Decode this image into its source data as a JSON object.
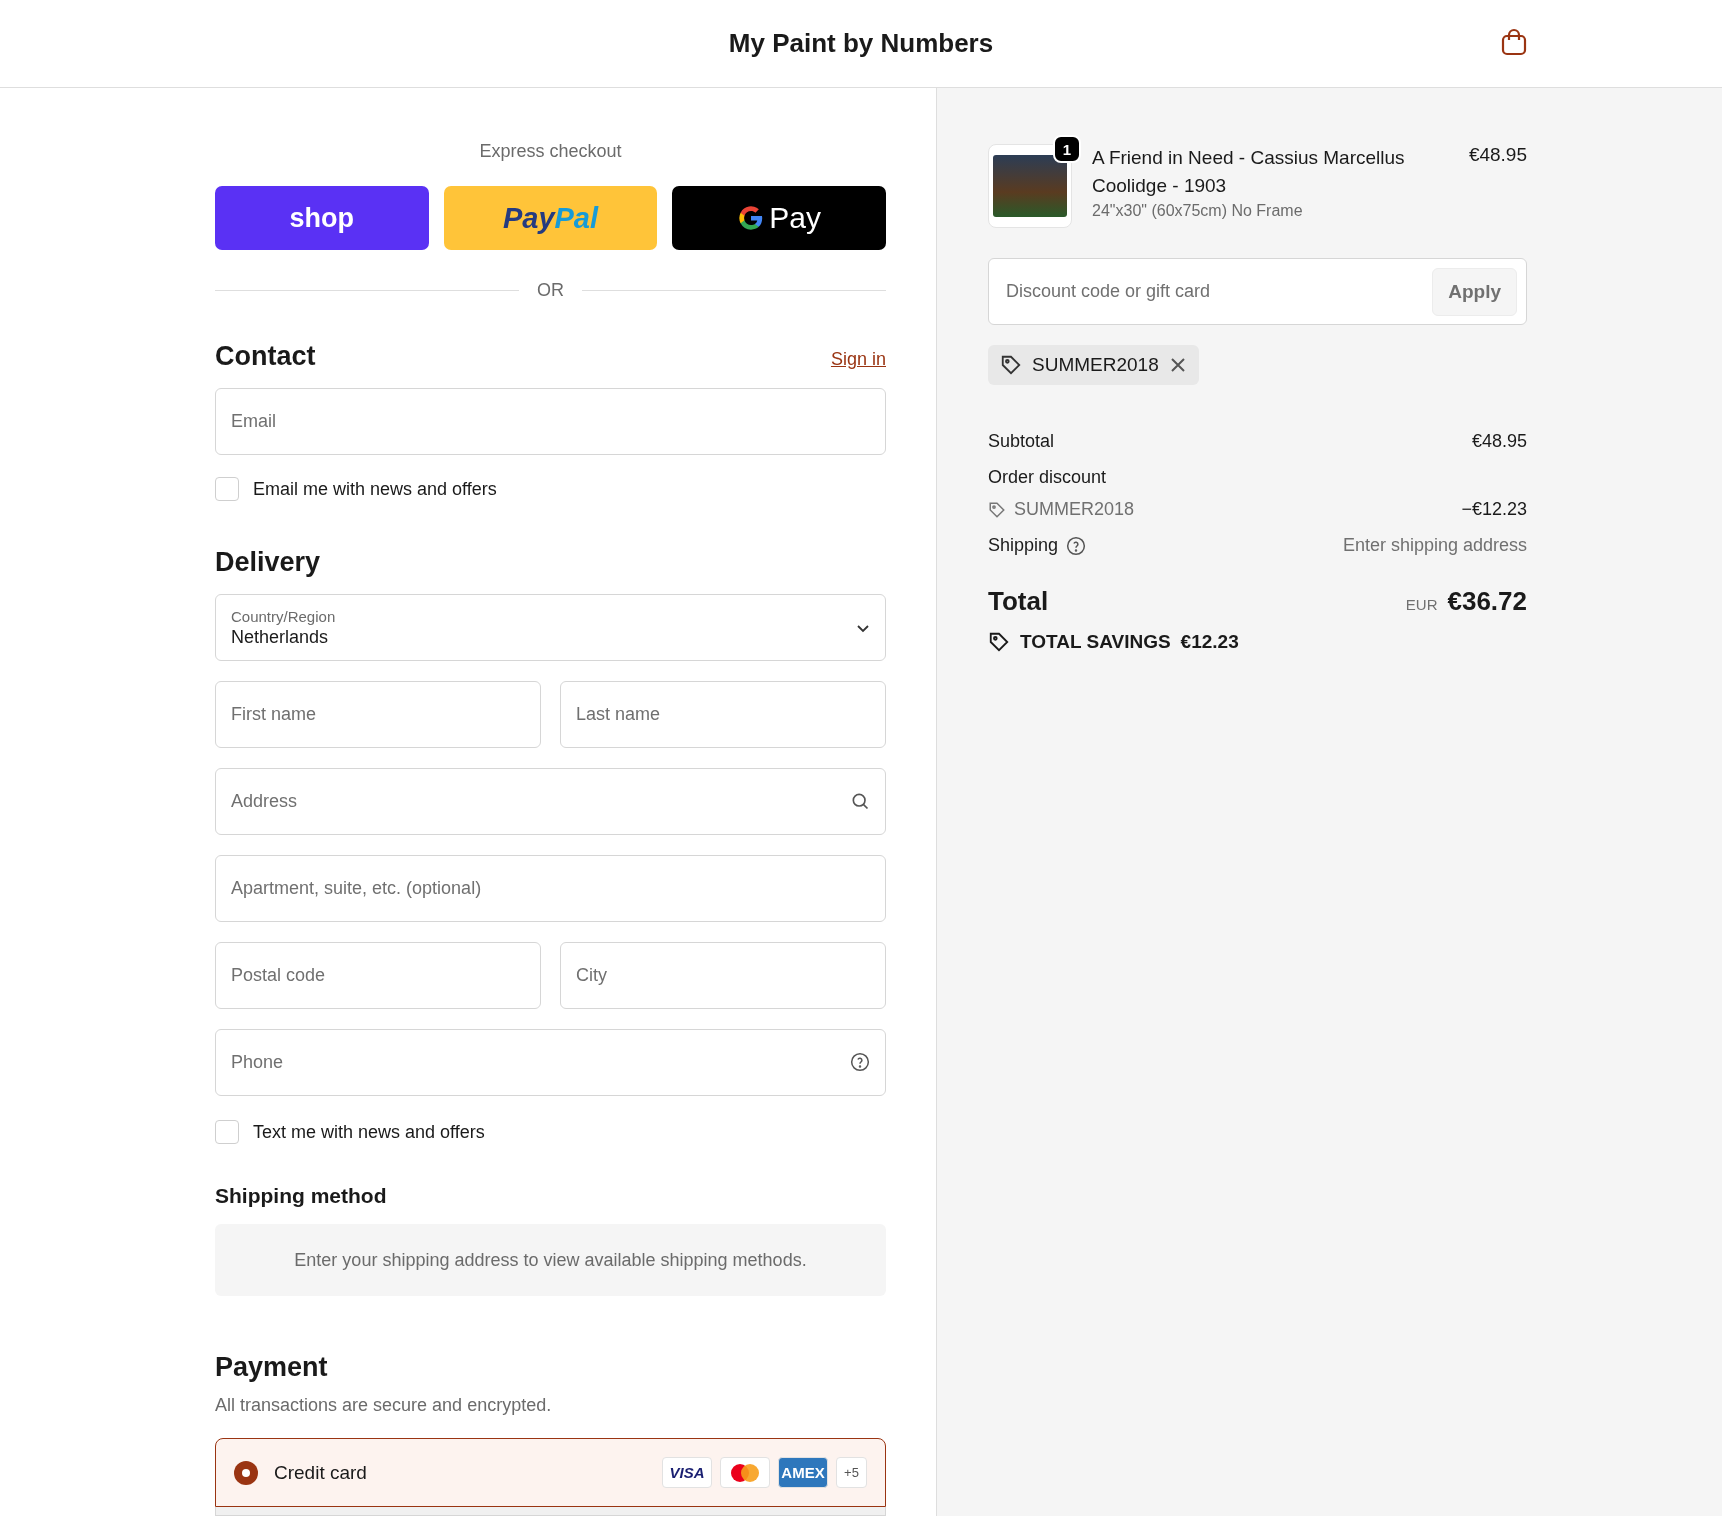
{
  "header": {
    "title": "My Paint by Numbers"
  },
  "express_checkout": {
    "title": "Express checkout",
    "buttons": [
      {
        "kind": "shop",
        "label": "shop"
      },
      {
        "kind": "paypal",
        "label": "Pay",
        "label_2": "Pal"
      },
      {
        "kind": "gpay",
        "label": "Pay"
      }
    ],
    "divider": "OR"
  },
  "contact": {
    "title": "Contact",
    "link": "Sign in",
    "email": {
      "placeholder": "Email"
    },
    "newsletter": {
      "label": "Email me with news and offers",
      "checked": false
    }
  },
  "delivery": {
    "title": "Delivery",
    "country": {
      "label": "Country/Region",
      "value": "Netherlands"
    },
    "fields": [
      [
        {
          "placeholder": "First name"
        },
        {
          "placeholder": "Last name"
        }
      ],
      [
        {
          "placeholder": "Address"
        }
      ],
      [
        {
          "placeholder": "Apartment, suite, etc. (optional)"
        }
      ],
      [
        {
          "placeholder": "Postal code"
        },
        {
          "placeholder": "City"
        }
      ],
      [
        {
          "placeholder": "Phone"
        }
      ]
    ],
    "sms": {
      "label": "Text me with news and offers",
      "checked": false
    }
  },
  "shipping_method": {
    "title": "Shipping method",
    "notice": "Enter your shipping address to view available shipping methods."
  },
  "payment": {
    "title": "Payment",
    "subtitle": "All transactions are secure and encrypted.",
    "methods": [
      {
        "label": "Credit card",
        "selected": true,
        "cards": [
          {
            "kind": "visa",
            "label": "VISA"
          },
          {
            "kind": "mastercard"
          },
          {
            "kind": "amex",
            "label": "AMEX"
          },
          {
            "kind": "more",
            "label": "+5"
          }
        ]
      }
    ]
  },
  "summary": {
    "items": [
      {
        "quantity": "1",
        "name": "A Friend in Need - Cassius Marcellus Coolidge - 1903",
        "variant": "24\"x30\" (60x75cm) No Frame",
        "price": "€48.95"
      }
    ],
    "discount": {
      "placeholder": "Discount code or gift card",
      "button": "Apply"
    },
    "applied_codes": [
      "SUMMER2018"
    ],
    "lines": [
      {
        "kind": "plain",
        "label": "Subtotal",
        "value": "€48.95"
      },
      {
        "kind": "discount",
        "label": "Order discount",
        "code": "SUMMER2018",
        "value": "−€12.23"
      },
      {
        "kind": "shipping",
        "label": "Shipping",
        "value": "Enter shipping address"
      }
    ],
    "total": {
      "label": "Total",
      "currency": "EUR",
      "value": "€36.72"
    },
    "savings": {
      "label": "TOTAL SAVINGS",
      "value": "€12.23"
    }
  }
}
